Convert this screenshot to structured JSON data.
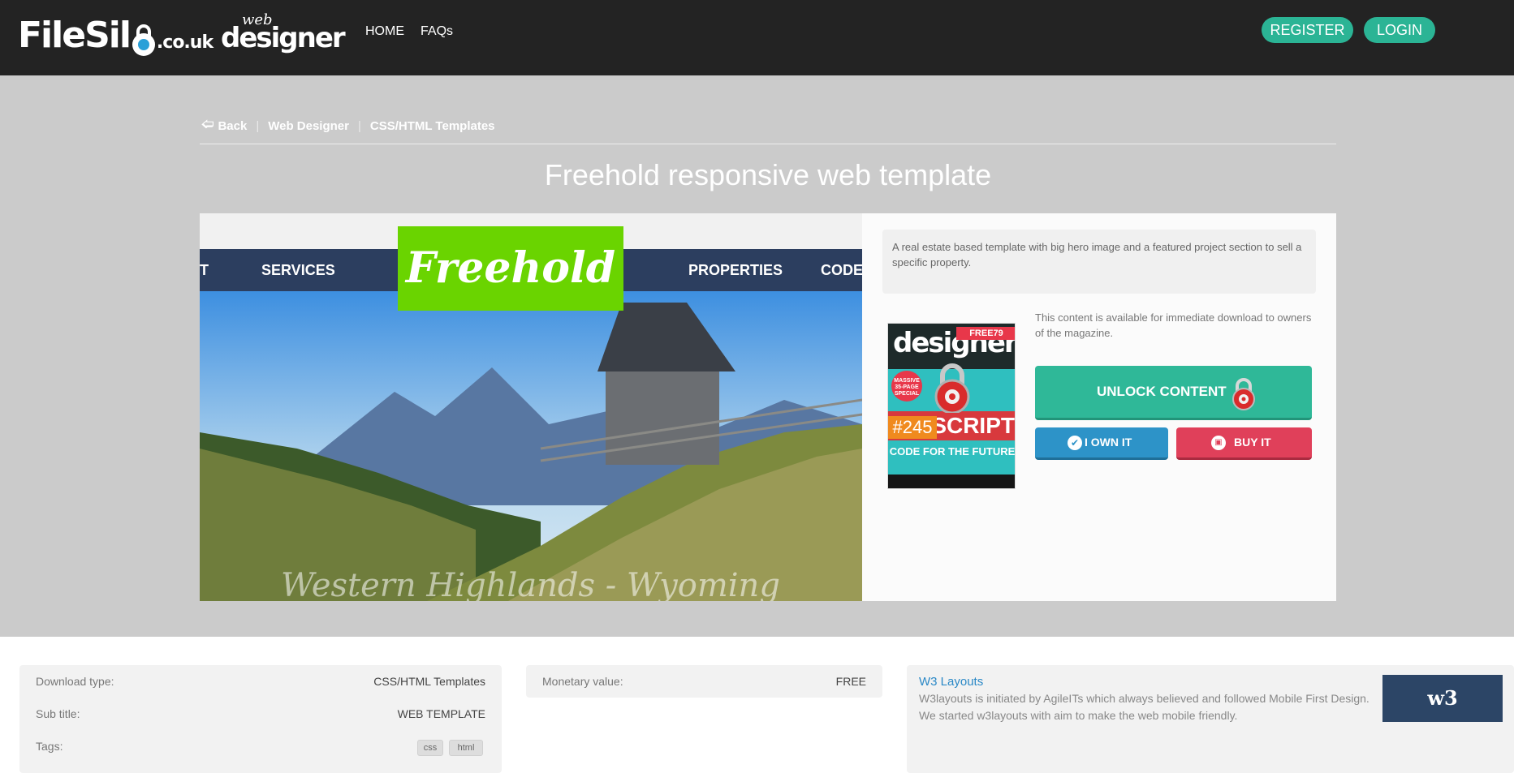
{
  "header": {
    "brand_main": "FileSil",
    "brand_tld": ".co.uk",
    "partner_top": "web",
    "partner_bottom": "designer",
    "nav": [
      "HOME",
      "FAQs"
    ],
    "register_label": "REGISTER",
    "login_label": "LOGIN"
  },
  "breadcrumb": {
    "back": "Back",
    "items": [
      "Web Designer",
      "CSS/HTML Templates"
    ]
  },
  "page_title": "Freehold responsive web template",
  "preview": {
    "logo": "Freehold",
    "nav_items": [
      "T",
      "SERVICES",
      "PROPERTIES",
      "CODES"
    ],
    "caption": "Western Highlands - Wyoming"
  },
  "description": "A real estate based template with big hero image and a featured project section to sell a specific property.",
  "magazine": {
    "masthead": "designer",
    "free_badge": "FREE79",
    "badge_text": "MASSIVE 35-PAGE SPECIAL",
    "headline": "SCRIPT",
    "issue": "#245",
    "cover_line": "CODE FOR THE FUTURE"
  },
  "availability": "This content is available for immediate download to owners of the magazine.",
  "actions": {
    "unlock": "UNLOCK CONTENT",
    "own": "I OWN IT",
    "buy": "BUY IT"
  },
  "details": {
    "download_type_label": "Download type:",
    "download_type_value": "CSS/HTML Templates",
    "subtitle_label": "Sub title:",
    "subtitle_value": "WEB TEMPLATE",
    "tags_label": "Tags:",
    "tags": [
      "css",
      "html"
    ],
    "monetary_label": "Monetary value:",
    "monetary_value": "FREE"
  },
  "credit": {
    "name": "W3 Layouts",
    "description": "W3layouts is initiated by AgileITs which always believed and followed Mobile First Design. We started w3layouts with aim to make the web mobile friendly.",
    "logo_text": "w3"
  },
  "colors": {
    "accent": "#2bb495",
    "topbar": "#232323",
    "band": "#cbcbcb",
    "own": "#2d93c8",
    "buy": "#e0405a"
  }
}
